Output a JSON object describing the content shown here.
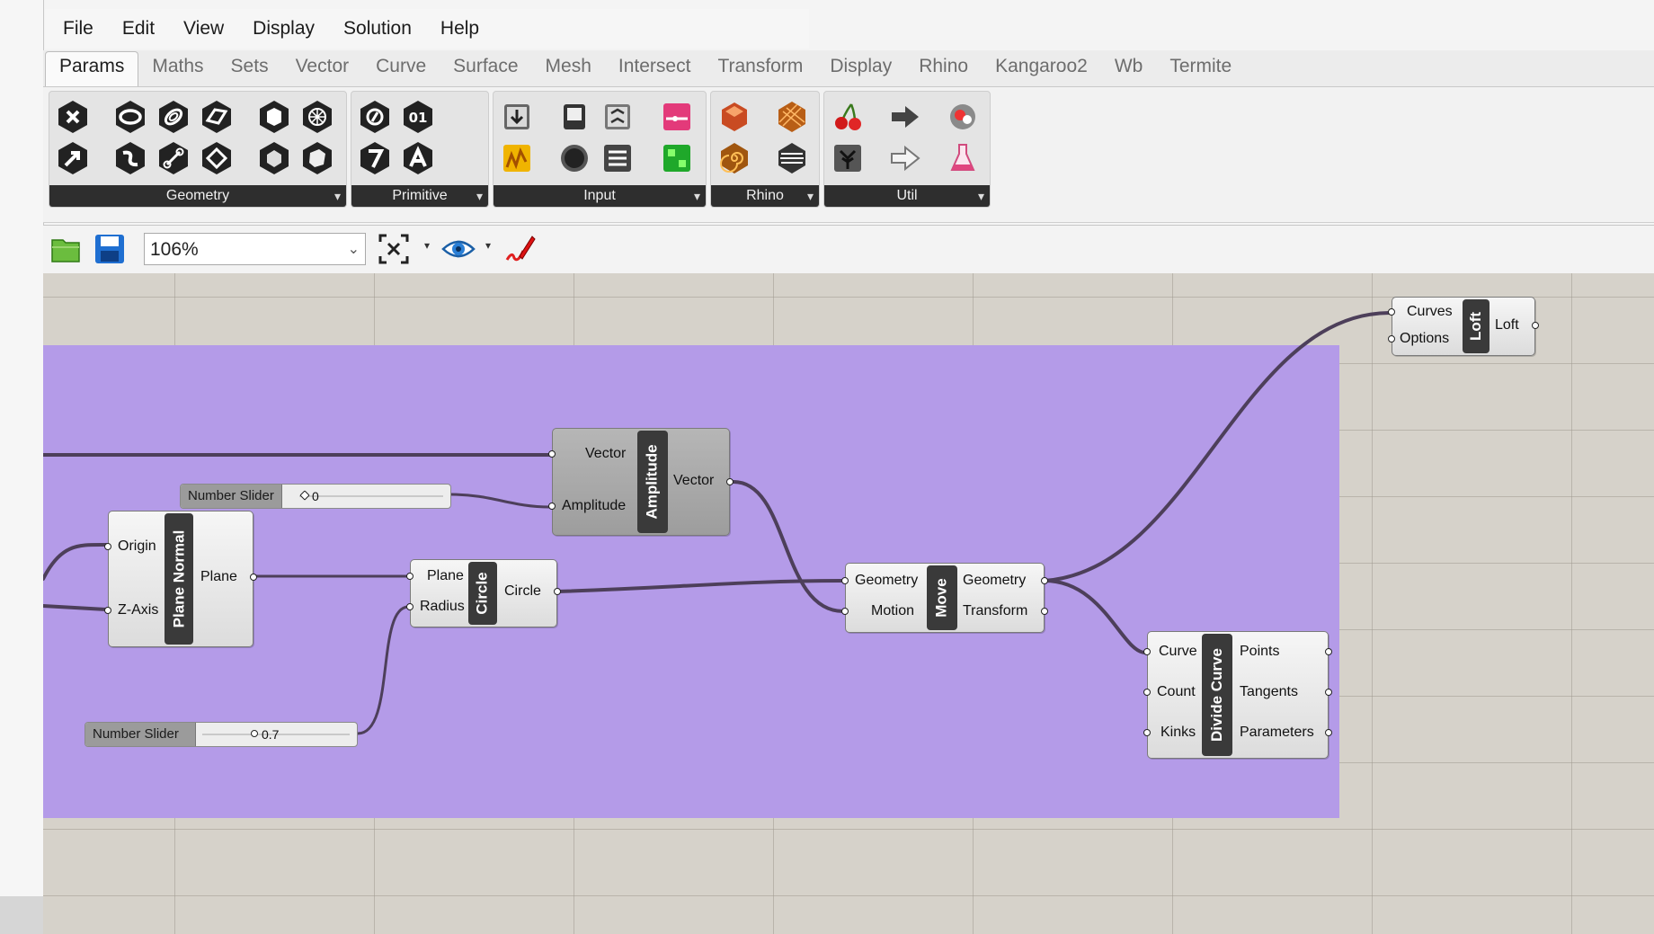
{
  "menu": [
    "File",
    "Edit",
    "View",
    "Display",
    "Solution",
    "Help"
  ],
  "tabs": [
    "Params",
    "Maths",
    "Sets",
    "Vector",
    "Curve",
    "Surface",
    "Mesh",
    "Intersect",
    "Transform",
    "Display",
    "Rhino",
    "Kangaroo2",
    "Wb",
    "Termite"
  ],
  "active_tab": "Params",
  "ribbon_panels": [
    "Geometry",
    "Primitive",
    "Input",
    "Rhino",
    "Util"
  ],
  "toolbar": {
    "zoom": "106%"
  },
  "components": {
    "amplitude": {
      "name": "Amplitude",
      "inputs": [
        "Vector",
        "Amplitude"
      ],
      "outputs": [
        "Vector"
      ]
    },
    "plane_normal": {
      "name": "Plane Normal",
      "inputs": [
        "Origin",
        "Z-Axis"
      ],
      "outputs": [
        "Plane"
      ]
    },
    "circle": {
      "name": "Circle",
      "inputs": [
        "Plane",
        "Radius"
      ],
      "outputs": [
        "Circle"
      ]
    },
    "move": {
      "name": "Move",
      "inputs": [
        "Geometry",
        "Motion"
      ],
      "outputs": [
        "Geometry",
        "Transform"
      ]
    },
    "divide_curve": {
      "name": "Divide Curve",
      "inputs": [
        "Curve",
        "Count",
        "Kinks"
      ],
      "outputs": [
        "Points",
        "Tangents",
        "Parameters"
      ]
    },
    "loft": {
      "name": "Loft",
      "inputs": [
        "Curves",
        "Options"
      ],
      "outputs": [
        "Loft"
      ]
    }
  },
  "sliders": [
    {
      "label": "Number Slider",
      "value": "0"
    },
    {
      "label": "Number Slider",
      "value": "0.7"
    }
  ],
  "colors": {
    "group": "#b49be8",
    "canvas": "#d6d2ca",
    "wire": "#4a3a5c"
  }
}
